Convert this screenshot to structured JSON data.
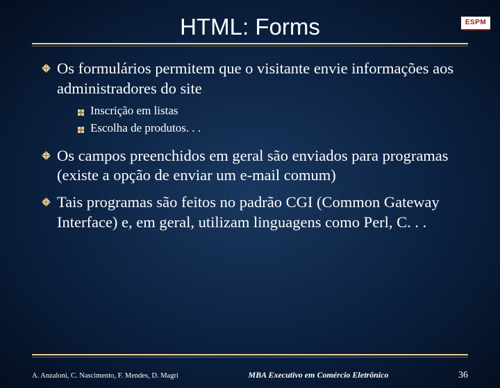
{
  "logo": "ESPM",
  "title": "HTML: Forms",
  "bullets": [
    {
      "text": "Os formulários permitem que o visitante envie informações aos administradores do site",
      "subs": [
        "Inscrição em listas",
        "Escolha de produtos. . ."
      ]
    },
    {
      "text": "Os campos preenchidos em geral são enviados para programas (existe a opção de enviar um e-mail comum)",
      "subs": []
    },
    {
      "text": "Tais programas são feitos no padrão CGI (Common Gateway Interface) e, em geral, utilizam linguagens como Perl, C. . .",
      "subs": []
    }
  ],
  "footer": {
    "left": "A. Anzaloni, C. Nascimento, F. Mendes, D. Magri",
    "center": "MBA Executivo em Comércio Eletrônico",
    "right": "36"
  }
}
